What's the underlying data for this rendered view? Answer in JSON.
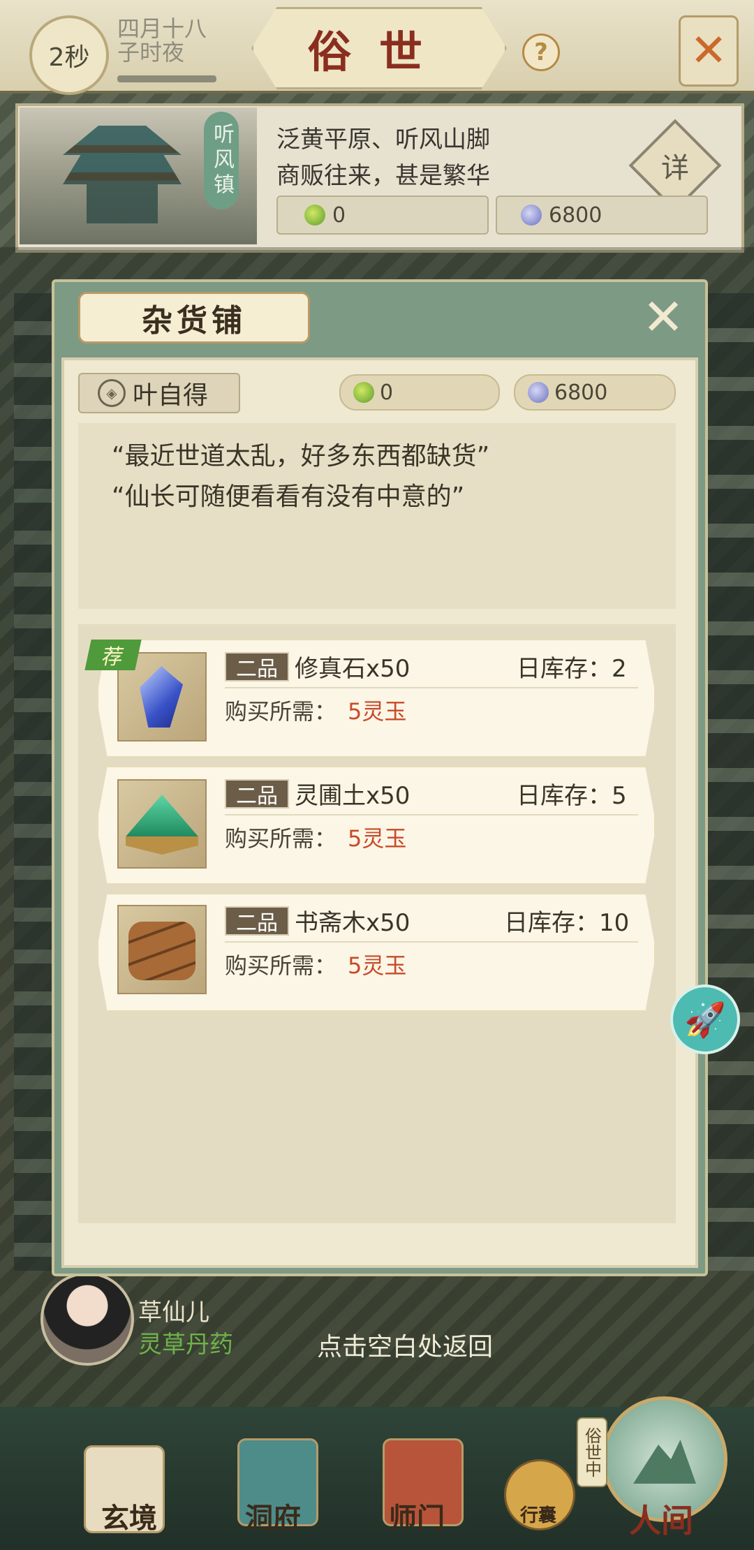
{
  "header": {
    "timer": "2秒",
    "date_line1": "四月十八",
    "date_line2": "子时夜",
    "title": "俗世",
    "help_icon": "?",
    "close_icon": "✕"
  },
  "location": {
    "town_name": "听风镇",
    "line1": "泛黄平原、听风山脚",
    "line2": "商贩往来，甚是繁华",
    "detail_label": "详",
    "jade": "0",
    "coins": "6800"
  },
  "dialog": {
    "title": "杂货铺",
    "close_icon": "✕",
    "shopkeeper": "叶自得",
    "jade": "0",
    "coins": "6800",
    "speech": [
      "“最近世道太乱，好多东西都缺货”",
      "“仙长可随便看看有没有中意的”"
    ],
    "recommend_tag": "荐",
    "items": [
      {
        "grade": "二品",
        "name": "修真石x50",
        "stock": "日库存：2",
        "price_label": "购买所需：",
        "price": "5灵玉",
        "icon": "crystal-icon"
      },
      {
        "grade": "二品",
        "name": "灵圃土x50",
        "stock": "日库存：5",
        "price_label": "购买所需：",
        "price": "5灵玉",
        "icon": "soil-icon"
      },
      {
        "grade": "二品",
        "name": "书斋木x50",
        "stock": "日库存：10",
        "price_label": "购买所需：",
        "price": "5灵玉",
        "icon": "wood-icon"
      }
    ]
  },
  "npc": {
    "name": "草仙儿",
    "role": "灵草丹药"
  },
  "back_hint": "点击空白处返回",
  "nav": {
    "items": [
      "玄境",
      "洞府",
      "师门",
      "行囊",
      "人间"
    ],
    "current_tag": "俗世中"
  },
  "colors": {
    "accent_red": "#8a2e20",
    "price_red": "#c94a2a",
    "dialog_frame": "#7d9a84",
    "role_green": "#6fb24a"
  }
}
